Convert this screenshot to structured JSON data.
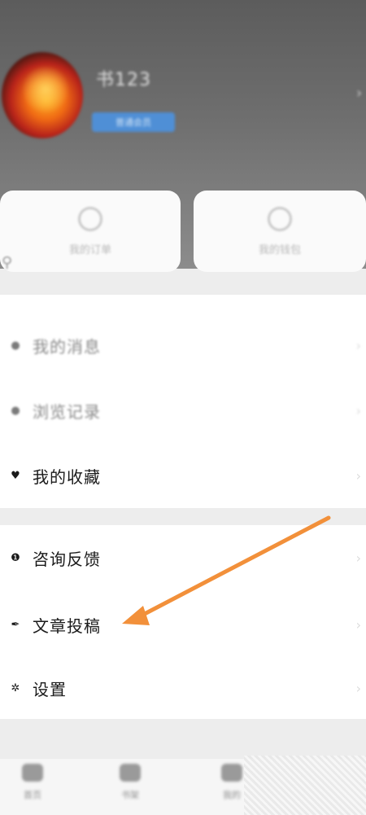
{
  "header": {
    "username": "书123",
    "badge": "普通会员"
  },
  "quick_actions": [
    {
      "label": "我的订单",
      "icon": "order-icon"
    },
    {
      "label": "我的钱包",
      "icon": "wallet-icon"
    }
  ],
  "menu_top": [
    {
      "label": "我的消息",
      "icon": "message-icon",
      "blurred": true
    },
    {
      "label": "浏览记录",
      "icon": "history-icon",
      "blurred": true
    },
    {
      "label": "我的收藏",
      "icon": "heart-icon",
      "blurred": false
    }
  ],
  "menu_bottom": [
    {
      "label": "咨询反馈",
      "icon": "info-icon"
    },
    {
      "label": "文章投稿",
      "icon": "pen-icon"
    },
    {
      "label": "设置",
      "icon": "gear-icon"
    }
  ],
  "tabbar": [
    {
      "label": "首页"
    },
    {
      "label": "书架"
    },
    {
      "label": "我的"
    }
  ],
  "annotation": {
    "color": "#f2903a"
  }
}
